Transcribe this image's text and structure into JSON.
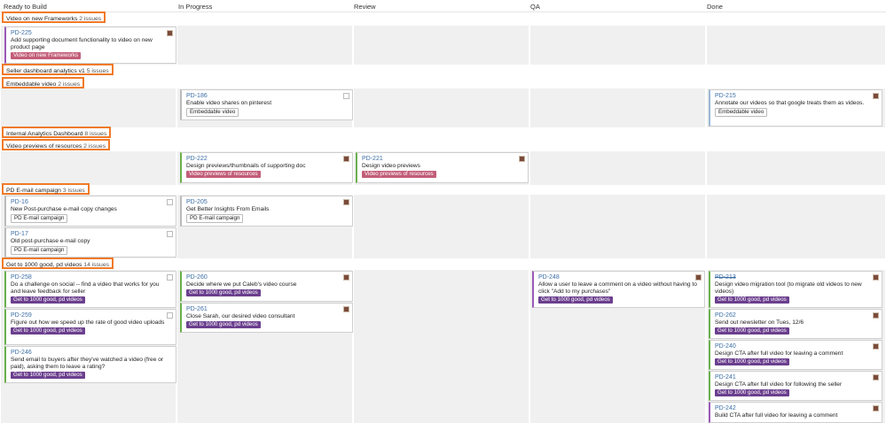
{
  "columns": [
    "Ready to Build",
    "In Progress",
    "Review",
    "QA",
    "Done"
  ],
  "colors": {
    "highlight": "#f07a28",
    "epic_pink": "#c25d78",
    "epic_purple": "#6b3f8e",
    "link": "#3b6ea5"
  },
  "swimlanes": [
    {
      "name": "Video on new Frameworks",
      "count": "2 issues"
    },
    {
      "name": "Seller dashboard analytics v1",
      "count": "5 issues"
    },
    {
      "name": "Embeddable video",
      "count": "2 issues"
    },
    {
      "name": "Internal Analytics Dashboard",
      "count": "8 issues"
    },
    {
      "name": "Video previews of resources",
      "count": "2 issues"
    },
    {
      "name": "PD E-mail campaign",
      "count": "3 issues"
    },
    {
      "name": "Get to 1000 good, pd videos",
      "count": "14 issues"
    }
  ],
  "cards": [
    {
      "key": "PD-225",
      "summary": "Add supporting document functionality to video on new product page",
      "epic": "Video on new Frameworks"
    },
    {
      "key": "PD-186",
      "summary": "Enable video shares on pinterest",
      "epic": "Embeddable video"
    },
    {
      "key": "PD-215",
      "summary": "Annotate our videos so that google treats them as videos.",
      "epic": "Embeddable video"
    },
    {
      "key": "PD-222",
      "summary": "Design previews/thumbnails of supporting doc",
      "epic": "Video previews of resources"
    },
    {
      "key": "PD-221",
      "summary": "Design video previews",
      "epic": "Video previews of resources"
    },
    {
      "key": "PD-16",
      "summary": "New Post-purchase e-mail copy changes",
      "epic": "PD E-mail campaign"
    },
    {
      "key": "PD-17",
      "summary": "Old post-purchase e-mail copy",
      "epic": "PD E-mail campaign"
    },
    {
      "key": "PD-205",
      "summary": "Get Better Insights From Emails",
      "epic": "PD E-mail campaign"
    },
    {
      "key": "PD-258",
      "summary": "Do a challenge on social -- find a video that works for you and leave feedback for seller",
      "epic": "Get to 1000 good, pd videos"
    },
    {
      "key": "PD-259",
      "summary": "Figure out how we speed up the rate of good video uploads",
      "epic": "Get to 1000 good, pd videos"
    },
    {
      "key": "PD-246",
      "summary": "Send email to buyers after they've watched a video (free or paid), asking them to leave a rating?",
      "epic": "Get to 1000 good, pd videos"
    },
    {
      "key": "PD-260",
      "summary": "Decide where we put Caleb's video course",
      "epic": "Get to 1000 good, pd videos"
    },
    {
      "key": "PD-261",
      "summary": "Close Sarah, our desired video consultant",
      "epic": "Get to 1000 good, pd videos"
    },
    {
      "key": "PD-248",
      "summary": "Allow a user to leave a comment on a video without having to click \"Add to my purchases\"",
      "epic": "Get to 1000 good, pd videos"
    },
    {
      "key": "PD-213",
      "summary": "Design video migration tool (to migrate old videos to new videos)",
      "epic": "Get to 1000 good, pd videos"
    },
    {
      "key": "PD-262",
      "summary": "Send out newsletter on Tues, 12/6",
      "epic": "Get to 1000 good, pd videos"
    },
    {
      "key": "PD-240",
      "summary": "Design CTA after full video for leaving a comment",
      "epic": "Get to 1000 good, pd videos"
    },
    {
      "key": "PD-241",
      "summary": "Design CTA after full video for following the seller",
      "epic": "Get to 1000 good, pd videos"
    },
    {
      "key": "PD-242",
      "summary": "Build CTA after full video for leaving a comment",
      "epic": ""
    }
  ]
}
